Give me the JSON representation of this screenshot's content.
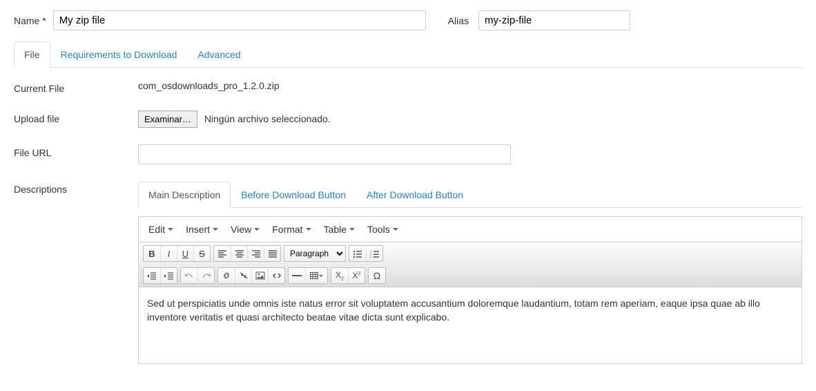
{
  "header": {
    "name_label": "Name *",
    "name_value": "My zip file",
    "alias_label": "Alias",
    "alias_value": "my-zip-file"
  },
  "main_tabs": {
    "file": "File",
    "requirements": "Requirements to Download",
    "advanced": "Advanced"
  },
  "labels": {
    "current_file": "Current File",
    "upload_file": "Upload file",
    "file_url": "File URL",
    "descriptions": "Descriptions"
  },
  "values": {
    "current_file": "com_osdownloads_pro_1.2.0.zip",
    "examine_btn": "Examinar…",
    "no_file_selected": "Ningún archivo seleccionado.",
    "file_url": ""
  },
  "desc_tabs": {
    "main": "Main Description",
    "before": "Before Download Button",
    "after": "After Download Button"
  },
  "editor_menus": {
    "edit": "Edit",
    "insert": "Insert",
    "view": "View",
    "format": "Format",
    "table": "Table",
    "tools": "Tools"
  },
  "editor": {
    "paragraph_label": "Paragraph",
    "content": "Sed ut perspiciatis unde omnis iste natus error sit voluptatem accusantium doloremque laudantium, totam rem aperiam, eaque ipsa quae ab illo inventore veritatis et quasi architecto beatae vitae dicta sunt explicabo."
  }
}
